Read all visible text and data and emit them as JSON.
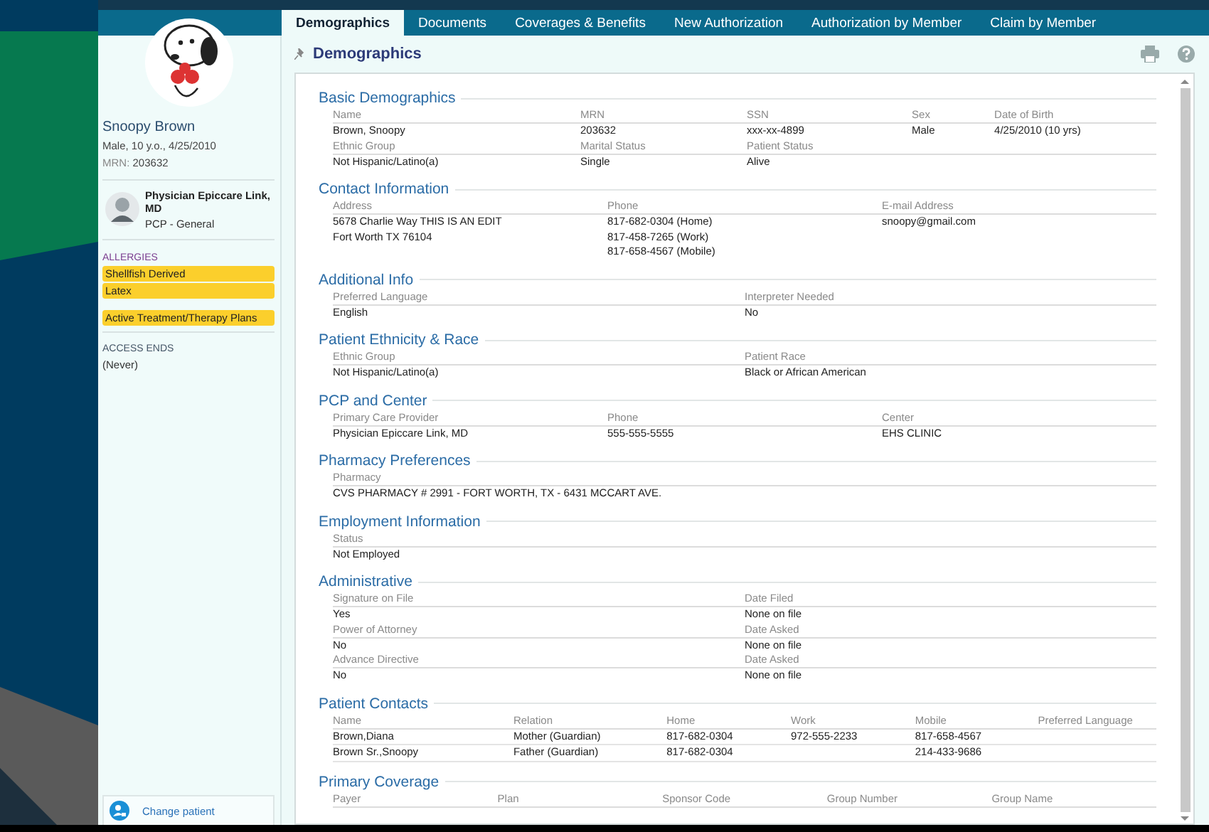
{
  "tabs": [
    {
      "label": "Demographics",
      "selected": true
    },
    {
      "label": "Documents",
      "selected": false
    },
    {
      "label": "Coverages & Benefits",
      "selected": false
    },
    {
      "label": "New Authorization",
      "selected": false
    },
    {
      "label": "Authorization by Member",
      "selected": false
    },
    {
      "label": "Claim by Member",
      "selected": false
    }
  ],
  "patient": {
    "name": "Snoopy Brown",
    "details": "Male, 10 y.o., 4/25/2010",
    "mrn_label": "MRN:",
    "mrn": "203632"
  },
  "pcp": {
    "name": "Physician Epiccare Link, MD",
    "role": "PCP - General"
  },
  "allergies": {
    "label": "ALLERGIES",
    "items": [
      "Shellfish Derived",
      "Latex"
    ]
  },
  "flags": [
    "Active Treatment/Therapy Plans"
  ],
  "access": {
    "label": "ACCESS ENDS",
    "value": "(Never)"
  },
  "change_patient": "Change patient",
  "page_title": "Demographics",
  "sections": [
    {
      "title": "Basic Demographics",
      "kind": "fields",
      "rows": [
        [
          {
            "label": "Name",
            "value": [
              "Brown, Snoopy"
            ]
          },
          {
            "label": "MRN",
            "value": [
              "203632"
            ]
          },
          {
            "label": "SSN",
            "value": [
              "xxx-xx-4899"
            ]
          },
          {
            "label": "Sex",
            "value": [
              "Male"
            ]
          },
          {
            "label": "Date of Birth",
            "value": [
              "4/25/2010 (10 yrs)"
            ]
          }
        ],
        [
          {
            "label": "Ethnic Group",
            "value": [
              "Not Hispanic/Latino(a)"
            ]
          },
          {
            "label": "Marital Status",
            "value": [
              "Single"
            ]
          },
          {
            "label": "Patient Status",
            "value": [
              "Alive"
            ]
          }
        ]
      ]
    },
    {
      "title": "Contact Information",
      "kind": "fields",
      "rows": [
        [
          {
            "label": "Address",
            "value": [
              "5678 Charlie Way THIS IS AN EDIT",
              "Fort Worth TX 76104"
            ]
          },
          {
            "label": "Phone",
            "value": [
              "817-682-0304 (Home)",
              "817-458-7265 (Work)",
              "817-658-4567 (Mobile)"
            ]
          },
          {
            "label": "E-mail Address",
            "value": [
              "snoopy@gmail.com"
            ]
          }
        ]
      ]
    },
    {
      "title": "Additional Info",
      "kind": "fields",
      "rows": [
        [
          {
            "label": "Preferred Language",
            "value": [
              "English"
            ]
          },
          {
            "label": "Interpreter Needed",
            "value": [
              "No"
            ]
          }
        ]
      ]
    },
    {
      "title": "Patient Ethnicity & Race",
      "kind": "fields",
      "rows": [
        [
          {
            "label": "Ethnic Group",
            "value": [
              "Not Hispanic/Latino(a)"
            ]
          },
          {
            "label": "Patient Race",
            "value": [
              "Black or African American"
            ]
          }
        ]
      ]
    },
    {
      "title": "PCP and Center",
      "kind": "fields",
      "rows": [
        [
          {
            "label": "Primary Care Provider",
            "value": [
              "Physician Epiccare Link, MD"
            ]
          },
          {
            "label": "Phone",
            "value": [
              "555-555-5555"
            ]
          },
          {
            "label": "Center",
            "value": [
              "EHS CLINIC"
            ]
          }
        ]
      ]
    },
    {
      "title": "Pharmacy Preferences",
      "kind": "fields",
      "rows": [
        [
          {
            "label": "Pharmacy",
            "value": [
              "CVS PHARMACY # 2991 - FORT WORTH, TX - 6431 MCCART AVE."
            ]
          }
        ]
      ]
    },
    {
      "title": "Employment Information",
      "kind": "fields",
      "rows": [
        [
          {
            "label": "Status",
            "value": [
              "Not Employed"
            ]
          }
        ]
      ]
    },
    {
      "title": "Administrative",
      "kind": "fields",
      "rows": [
        [
          {
            "label": "Signature on File",
            "value": [
              "Yes"
            ]
          },
          {
            "label": "Date Filed",
            "value": [
              "None on file"
            ]
          }
        ],
        [
          {
            "label": "Power of Attorney",
            "value": [
              "No"
            ]
          },
          {
            "label": "Date Asked",
            "value": [
              "None on file"
            ]
          }
        ],
        [
          {
            "label": "Advance Directive",
            "value": [
              "No"
            ]
          },
          {
            "label": "Date Asked",
            "value": [
              "None on file"
            ]
          }
        ]
      ]
    },
    {
      "title": "Patient Contacts",
      "kind": "table",
      "columns": [
        "Name",
        "Relation",
        "Home",
        "Work",
        "Mobile",
        "Preferred Language"
      ],
      "rows": [
        [
          "Brown,Diana",
          "Mother (Guardian)",
          "817-682-0304",
          "972-555-2233",
          "817-658-4567",
          ""
        ],
        [
          "Brown Sr.,Snoopy",
          "Father (Guardian)",
          "817-682-0304",
          "",
          "214-433-9686",
          ""
        ]
      ]
    },
    {
      "title": "Primary Coverage",
      "kind": "table",
      "columns": [
        "Payer",
        "Plan",
        "Sponsor Code",
        "Group Number",
        "Group Name"
      ]
    }
  ]
}
